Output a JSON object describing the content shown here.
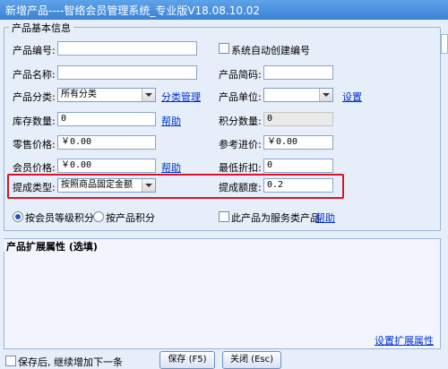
{
  "window": {
    "title": "新增产品----智络会员管理系统_专业版V18.08.10.02"
  },
  "basic": {
    "group_title": "产品基本信息",
    "code_label": "产品编号:",
    "code_value": "",
    "auto_code_label": "系统自动创建编号",
    "auto_code_checked": false,
    "name_label": "产品名称:",
    "name_value": "",
    "short_label": "产品简码:",
    "short_value": "",
    "category_label": "产品分类:",
    "category_value": "所有分类",
    "category_manage_link": "分类管理",
    "unit_label": "产品单位:",
    "unit_value": "",
    "unit_set_link": "设置",
    "stock_label": "库存数量:",
    "stock_value": "0",
    "stock_help_link": "帮助",
    "points_label": "积分数量:",
    "points_value": "0",
    "retail_label": "零售价格:",
    "retail_value": "￥0.00",
    "cost_label": "参考进价:",
    "cost_value": "￥0.00",
    "member_price_label": "会员价格:",
    "member_price_value": "￥0.00",
    "member_help_link": "帮助",
    "min_discount_label": "最低折扣:",
    "min_discount_value": "0",
    "commission_type_label": "提成类型:",
    "commission_type_value": "按照商品固定金额",
    "commission_amount_label": "提成额度:",
    "commission_amount_value": "0.2",
    "radio_level_label": "按会员等级积分",
    "radio_product_label": "按产品积分",
    "service_label": "此产品为服务类产品",
    "service_help_link": "帮助"
  },
  "ext": {
    "tab_label": "产品扩展属性 (选填)",
    "set_link": "设置扩展属性"
  },
  "footer": {
    "continue_label": "保存后, 继续增加下一条",
    "save_label": "保存 (F5)",
    "close_label": "关闭 (Esc)"
  }
}
